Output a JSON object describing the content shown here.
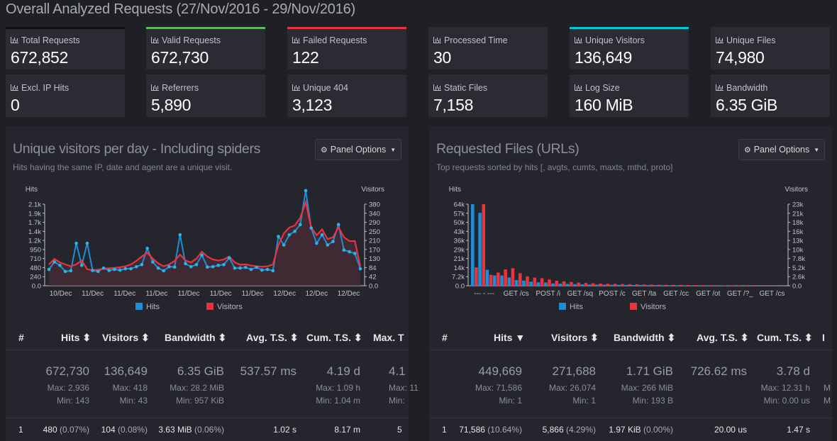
{
  "title": "Overall Analyzed Requests (27/Nov/2016 - 29/Nov/2016)",
  "colors": {
    "bg": "#1f2026",
    "card": "#2b2c33",
    "hits": "#1f8dd6",
    "visitors": "#e8343f",
    "green": "#5cb85c",
    "red": "#e8343f",
    "cyan": "#00c4d6"
  },
  "cards": [
    {
      "label": "Total Requests",
      "value": "672,852"
    },
    {
      "label": "Valid Requests",
      "value": "672,730"
    },
    {
      "label": "Failed Requests",
      "value": "122"
    },
    {
      "label": "Processed Time",
      "value": "30"
    },
    {
      "label": "Unique Visitors",
      "value": "136,649"
    },
    {
      "label": "Unique Files",
      "value": "74,980"
    },
    {
      "label": "Excl. IP Hits",
      "value": "0"
    },
    {
      "label": "Referrers",
      "value": "5,890"
    },
    {
      "label": "Unique 404",
      "value": "3,123"
    },
    {
      "label": "Static Files",
      "value": "7,158"
    },
    {
      "label": "Log Size",
      "value": "160 MiB"
    },
    {
      "label": "Bandwidth",
      "value": "6.35 GiB"
    }
  ],
  "left": {
    "title": "Unique visitors per day - Including spiders",
    "subtitle": "Hits having the same IP, date and agent are a unique visit.",
    "options_label": "Panel Options",
    "headers": {
      "num": "#",
      "hits": "Hits",
      "visitors": "Visitors",
      "bandwidth": "Bandwidth",
      "avgts": "Avg. T.S.",
      "cumts": "Cum. T.S.",
      "maxts": "Max. T"
    },
    "summary": {
      "hits": "672,730",
      "hits_max": "Max: 2,936",
      "hits_min": "Min: 143",
      "visitors": "136,649",
      "visitors_max": "Max: 418",
      "visitors_min": "Min: 43",
      "bandwidth": "6.35 GiB",
      "bandwidth_max": "Max: 28.2 MiB",
      "bandwidth_min": "Min: 957 KiB",
      "avgts": "537.57 ms",
      "cumts": "4.19 d",
      "cumts_max": "Max: 1.09 h",
      "cumts_min": "Min: 1.04 m",
      "maxts": "4.1",
      "maxts_max": "Max: 11",
      "maxts_min": "Min:"
    },
    "row": {
      "num": "1",
      "hits": "480",
      "hits_pct": "(0.07%)",
      "visitors": "104",
      "visitors_pct": "(0.08%)",
      "bandwidth": "3.63 MiB",
      "bandwidth_pct": "(0.06%)",
      "avgts": "1.02 s",
      "cumts": "8.17 m",
      "maxts": "5"
    },
    "legend": {
      "hits": "Hits",
      "visitors": "Visitors"
    }
  },
  "right": {
    "title": "Requested Files (URLs)",
    "subtitle": "Top requests sorted by hits [, avgts, cumts, maxts, mthd, proto]",
    "options_label": "Panel Options",
    "headers": {
      "num": "#",
      "hits": "Hits",
      "visitors": "Visitors",
      "bandwidth": "Bandwidth",
      "avgts": "Avg. T.S.",
      "cumts": "Cum. T.S.",
      "maxts": "I"
    },
    "summary": {
      "hits": "449,669",
      "hits_max": "Max: 71,586",
      "hits_min": "Min: 1",
      "visitors": "271,688",
      "visitors_max": "Max: 26,074",
      "visitors_min": "Min: 1",
      "bandwidth": "1.71 GiB",
      "bandwidth_max": "Max: 266 MiB",
      "bandwidth_min": "Min: 193 B",
      "avgts": "726.62 ms",
      "cumts": "3.78 d",
      "cumts_max": "Max: 12.31 h",
      "cumts_min": "Min: 0.00 us",
      "maxts_max": "M",
      "maxts_min": "M"
    },
    "row": {
      "num": "1",
      "hits": "71,586",
      "hits_pct": "(10.64%)",
      "visitors": "5,866",
      "visitors_pct": "(4.29%)",
      "bandwidth": "1.97 KiB",
      "bandwidth_pct": "(0.00%)",
      "avgts": "20.00 us",
      "cumts": "1.47 s",
      "maxts": ""
    },
    "legend": {
      "hits": "Hits",
      "visitors": "Visitors"
    }
  },
  "chart_data": [
    {
      "type": "line",
      "ylabel": "Hits",
      "y2label": "Visitors",
      "yticks": [
        "2.1k",
        "1.9k",
        "1.7k",
        "1.4k",
        "1.2k",
        "950",
        "710",
        "480",
        "240",
        "0.0"
      ],
      "y2ticks": [
        "380",
        "340",
        "290",
        "250",
        "210",
        "170",
        "130",
        "84",
        "42",
        "0.0"
      ],
      "xticks": [
        "10/Dec",
        "11/Dec",
        "11/Dec",
        "11/Dec",
        "11/Dec",
        "11/Dec",
        "11/Dec",
        "12/Dec",
        "12/Dec",
        "12/Dec"
      ],
      "ylim": [
        0,
        2400
      ],
      "y2lim": [
        0,
        420
      ],
      "series": [
        {
          "name": "Hits",
          "values": [
            480,
            700,
            600,
            420,
            440,
            1250,
            600,
            1250,
            450,
            420,
            520,
            450,
            480,
            460,
            500,
            500,
            560,
            620,
            1100,
            700,
            520,
            440,
            560,
            550,
            1500,
            650,
            560,
            620,
            900,
            550,
            560,
            600,
            620,
            820,
            520,
            520,
            540,
            480,
            540,
            460,
            480,
            440,
            1450,
            1200,
            1500,
            1600,
            1800,
            2800,
            1700,
            1250,
            1500,
            1200,
            1300,
            1800,
            1050,
            1000,
            950,
            500
          ]
        },
        {
          "name": "Visitors",
          "values": [
            110,
            138,
            120,
            110,
            100,
            110,
            130,
            85,
            80,
            82,
            88,
            90,
            92,
            95,
            100,
            110,
            128,
            150,
            170,
            140,
            115,
            100,
            110,
            128,
            160,
            130,
            120,
            140,
            175,
            150,
            135,
            130,
            135,
            150,
            120,
            108,
            110,
            104,
            100,
            98,
            100,
            110,
            210,
            270,
            300,
            310,
            350,
            430,
            300,
            260,
            290,
            240,
            250,
            300,
            250,
            230,
            230,
            100
          ]
        }
      ]
    },
    {
      "type": "bar",
      "ylabel": "Hits",
      "y2label": "Visitors",
      "yticks": [
        "64k",
        "57k",
        "50k",
        "43k",
        "36k",
        "29k",
        "21k",
        "14k",
        "7.2k",
        "0.0"
      ],
      "y2ticks": [
        "23k",
        "21k",
        "18k",
        "16k",
        "13k",
        "10k",
        "7.8k",
        "5.2k",
        "2.6k",
        "0.0"
      ],
      "xticks": [
        "--- - ---",
        "GET /cs",
        "POST /і",
        "GET /sq",
        "POST /c",
        "GET /ta",
        "GET /cc",
        "GET /ot",
        "GET /?_",
        "GET /cs"
      ],
      "ylim": [
        0,
        71586
      ],
      "y2lim": [
        0,
        26074
      ],
      "series": [
        {
          "name": "Hits",
          "values": [
            71586,
            64000,
            14000,
            9000,
            9000,
            7200,
            5000,
            4500,
            3600,
            3000,
            2800,
            2000,
            1800,
            1600,
            1400,
            1200,
            1100,
            1000,
            900,
            800,
            700,
            650,
            600,
            550,
            500,
            450,
            400,
            380,
            350,
            320,
            300,
            280,
            260,
            240,
            220,
            200,
            180,
            160,
            140,
            120,
            100,
            90,
            80
          ]
        },
        {
          "name": "Visitors",
          "values": [
            5866,
            26074,
            3500,
            4200,
            5200,
            5600,
            4000,
            3000,
            2600,
            2400,
            2000,
            1600,
            1400,
            1200,
            1000,
            900,
            800,
            700,
            650,
            600,
            550,
            500,
            450,
            400,
            350,
            300,
            280,
            260,
            240,
            220,
            200,
            180,
            160,
            140,
            120,
            110,
            100,
            90,
            80,
            70,
            60,
            50,
            40
          ]
        }
      ]
    }
  ]
}
